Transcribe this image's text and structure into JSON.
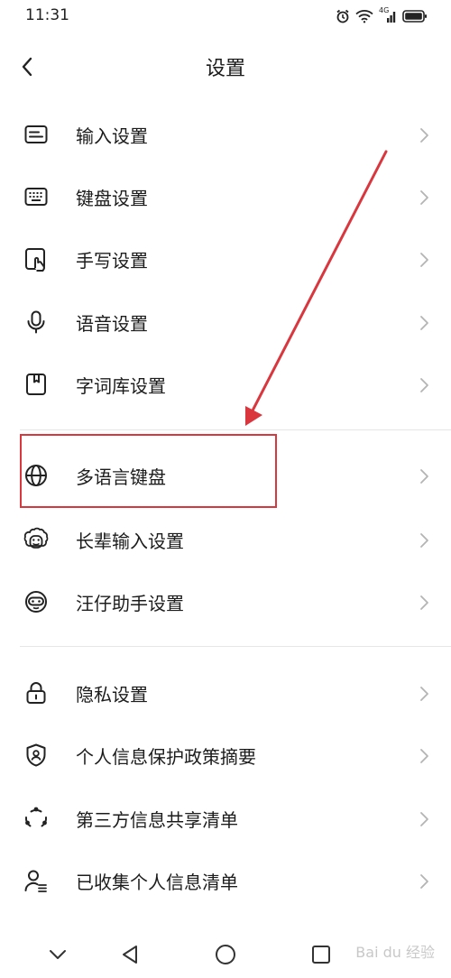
{
  "status_bar": {
    "time": "11:31",
    "network_label": "4G"
  },
  "header": {
    "title": "设置"
  },
  "settings": {
    "items": [
      {
        "label": "输入设置",
        "icon": "input-settings-icon"
      },
      {
        "label": "键盘设置",
        "icon": "keyboard-icon"
      },
      {
        "label": "手写设置",
        "icon": "handwriting-icon"
      },
      {
        "label": "语音设置",
        "icon": "microphone-icon"
      },
      {
        "label": "字词库设置",
        "icon": "dictionary-icon"
      },
      {
        "label": "多语言键盘",
        "icon": "globe-icon",
        "highlighted": true
      },
      {
        "label": "长辈输入设置",
        "icon": "elder-face-icon"
      },
      {
        "label": "汪仔助手设置",
        "icon": "assistant-mascot-icon"
      },
      {
        "label": "隐私设置",
        "icon": "lock-icon"
      },
      {
        "label": "个人信息保护政策摘要",
        "icon": "shield-user-icon"
      },
      {
        "label": "第三方信息共享清单",
        "icon": "share-nodes-icon"
      },
      {
        "label": "已收集个人信息清单",
        "icon": "user-list-icon"
      }
    ]
  },
  "annotation": {
    "highlight_color": "#d9363e"
  },
  "nav_bar": {
    "buttons": [
      "collapse-icon",
      "back-triangle-icon",
      "home-circle-icon",
      "recents-square-icon"
    ]
  },
  "watermark": {
    "text": "Bai du 经验"
  }
}
